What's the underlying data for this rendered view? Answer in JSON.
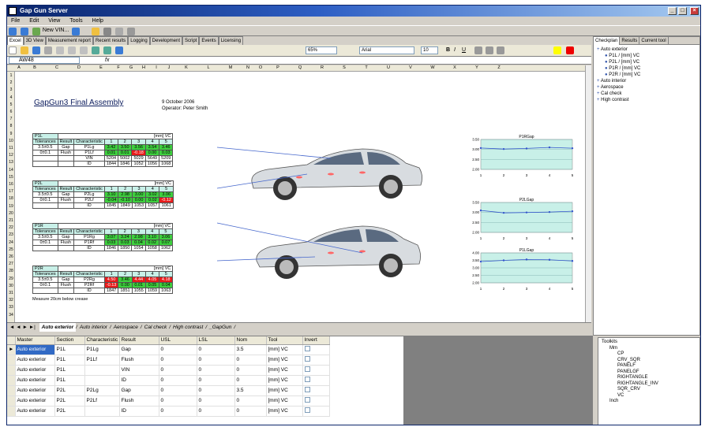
{
  "window": {
    "title": "Gap Gun Server"
  },
  "menu": [
    "File",
    "Edit",
    "View",
    "Tools",
    "Help"
  ],
  "toolbar": {
    "new_vin": "New VIN..."
  },
  "main_tabs": [
    "Excel",
    "3D View",
    "Measurement report",
    "Recent results",
    "Logging",
    "Development",
    "Script",
    "Events",
    "Licensing"
  ],
  "formatbar": {
    "zoom": "65%",
    "font": "Arial",
    "size": "10"
  },
  "namebox": "AW48",
  "fx": "fx",
  "columns": [
    "A",
    "B",
    "C",
    "D",
    "E",
    "F",
    "G",
    "H",
    "I",
    "J",
    "K",
    "L",
    "M",
    "N",
    "O",
    "P",
    "Q",
    "R",
    "S",
    "T",
    "U",
    "V",
    "W",
    "X",
    "Y",
    "Z"
  ],
  "sheet": {
    "title": "GapGun3 Final Assembly",
    "date": "9 October 2006",
    "operator": "Operator: Peter Smith",
    "footnote": "Measure 20cm below crease",
    "tables": [
      {
        "id": "P1L",
        "unit": "[mm] VC",
        "tol_label": "Tolerances",
        "res_label": "Result",
        "char_label": "Characteristic",
        "tol": [
          "3.5±0.5",
          "0±0.1"
        ],
        "rows": [
          {
            "res": "Gap",
            "char": "P1Lg",
            "vals": [
              "3.42",
              "3.50",
              "3.56",
              "3.54",
              "3.46"
            ],
            "cls": [
              "g",
              "g",
              "g",
              "g",
              "g"
            ]
          },
          {
            "res": "Flush",
            "char": "P1Lf",
            "vals": [
              "0.01",
              "0.01",
              "-0.18",
              "0.00",
              "0.03"
            ],
            "cls": [
              "g",
              "g",
              "r",
              "g",
              "g"
            ]
          },
          {
            "res": "",
            "char": "VIN",
            "vals": [
              "5204",
              "5002",
              "5029",
              "5649",
              "5209"
            ],
            "cls": [
              "",
              "",
              "",
              "",
              ""
            ]
          },
          {
            "res": "",
            "char": "ID",
            "vals": [
              "1844",
              "1846",
              "1052",
              "1056",
              "1068"
            ],
            "cls": [
              "",
              "",
              "",
              "",
              ""
            ]
          }
        ]
      },
      {
        "id": "P2L",
        "unit": "[mm] VC",
        "tol_label": "Tolerances",
        "res_label": "Result",
        "char_label": "Characteristic",
        "tol": [
          "3.5±0.5",
          "0±0.1"
        ],
        "rows": [
          {
            "res": "Gap",
            "char": "P2Lg",
            "vals": [
              "3.10",
              "2.98",
              "3.00",
              "3.02",
              "3.06"
            ],
            "cls": [
              "g",
              "g",
              "g",
              "g",
              "g"
            ]
          },
          {
            "res": "Flush",
            "char": "P2Lf",
            "vals": [
              "-0.04",
              "-0.10",
              "0.00",
              "0.02",
              "-0.12"
            ],
            "cls": [
              "g",
              "g",
              "g",
              "g",
              "r"
            ]
          },
          {
            "res": "",
            "char": "ID",
            "vals": [
              "1845",
              "1849",
              "1053",
              "1057",
              "1061"
            ],
            "cls": [
              "",
              "",
              "",
              "",
              ""
            ]
          }
        ]
      },
      {
        "id": "P1R",
        "unit": "[mm] VC",
        "tol_label": "Tolerances",
        "res_label": "Result",
        "char_label": "Characteristic",
        "tol": [
          "3.5±0.5",
          "0±0.1"
        ],
        "note": "...\\Manage.cap\\sound\\GapGun3\\meas... INW...",
        "rows": [
          {
            "res": "Gap",
            "char": "P1Rg",
            "vals": [
              "3.07",
              "3.24",
              "2.98",
              "3.10",
              "3.06"
            ],
            "cls": [
              "g",
              "g",
              "g",
              "g",
              "g"
            ]
          },
          {
            "res": "Flush",
            "char": "P1Rf",
            "vals": [
              "0.03",
              "0.03",
              "0.04",
              "0.02",
              "0.07"
            ],
            "cls": [
              "g",
              "g",
              "g",
              "g",
              "g"
            ]
          },
          {
            "res": "",
            "char": "ID",
            "vals": [
              "1846",
              "1850",
              "1054",
              "1058",
              "1062"
            ],
            "cls": [
              "",
              "",
              "",
              "",
              ""
            ]
          }
        ]
      },
      {
        "id": "P2R",
        "unit": "[mm] VC",
        "tol_label": "Tolerances",
        "res_label": "Result",
        "char_label": "Characteristic",
        "tol": [
          "3.5±0.5",
          "0±0.1"
        ],
        "note": "INW...",
        "rows": [
          {
            "res": "Gap",
            "char": "P2Rg",
            "vals": [
              "4.50",
              "3.46",
              "4.44",
              "4.05",
              "4.18"
            ],
            "cls": [
              "r",
              "g",
              "r",
              "r",
              "r"
            ]
          },
          {
            "res": "Flush",
            "char": "P2Rf",
            "vals": [
              "-0.13",
              "0.00",
              "0.01",
              "0.05",
              "0.04"
            ],
            "cls": [
              "r",
              "g",
              "g",
              "g",
              "g"
            ]
          },
          {
            "res": "",
            "char": "ID",
            "vals": [
              "1847",
              "1851",
              "1055",
              "1059",
              "1063"
            ],
            "cls": [
              "",
              "",
              "",
              "",
              ""
            ]
          }
        ]
      }
    ],
    "col_nums": [
      "1",
      "2",
      "3",
      "4",
      "5"
    ]
  },
  "chart_data": [
    {
      "type": "line",
      "title": "P1RGap",
      "x": [
        1,
        2,
        3,
        4,
        5
      ],
      "values": [
        3.07,
        3.02,
        3.05,
        3.1,
        3.06
      ],
      "ylim": [
        2.0,
        3.5
      ],
      "yticks": [
        "3.50",
        "3.00",
        "2.50",
        "2.00"
      ]
    },
    {
      "type": "line",
      "title": "P2LGap",
      "x": [
        1,
        2,
        3,
        4,
        5
      ],
      "values": [
        3.1,
        2.98,
        3.0,
        3.02,
        3.06
      ],
      "ylim": [
        2.0,
        3.5
      ],
      "yticks": [
        "3.50",
        "3.00",
        "2.50",
        "2.00"
      ]
    },
    {
      "type": "line",
      "title": "P1LGap",
      "x": [
        1,
        2,
        3,
        4,
        5
      ],
      "values": [
        3.42,
        3.5,
        3.56,
        3.54,
        3.46
      ],
      "ylim": [
        2.0,
        4.0
      ],
      "yticks": [
        "4.00",
        "3.50",
        "3.00",
        "2.50",
        "2.00"
      ]
    }
  ],
  "sheet_tabs": [
    "Auto exterior",
    "Auto interior",
    "Aerospace",
    "Cal check",
    "High contrast",
    "_GapGun"
  ],
  "right_tabs": [
    "Checkplan",
    "Results",
    "Current tool"
  ],
  "tree": [
    {
      "t": "Auto exterior",
      "lvl": 0
    },
    {
      "t": "P1L / [mm] VC",
      "lvl": 1
    },
    {
      "t": "P2L / [mm] VC",
      "lvl": 1
    },
    {
      "t": "P1R / [mm] VC",
      "lvl": 1
    },
    {
      "t": "P2R / [mm] VC",
      "lvl": 1
    },
    {
      "t": "Auto interior",
      "lvl": 0
    },
    {
      "t": "Aerospace",
      "lvl": 0
    },
    {
      "t": "Cal check",
      "lvl": 0
    },
    {
      "t": "High contrast",
      "lvl": 0
    }
  ],
  "grid": {
    "headers": [
      "Master",
      "Section",
      "Characteristic",
      "Result",
      "USL",
      "LSL",
      "Nom",
      "Tool",
      "Invert"
    ],
    "rows": [
      [
        "Auto exterior",
        "P1L",
        "P1Lg",
        "Gap",
        "0",
        "0",
        "3.5",
        "[mm] VC"
      ],
      [
        "Auto exterior",
        "P1L",
        "P1Lf",
        "Flush",
        "0",
        "0",
        "0",
        "[mm] VC"
      ],
      [
        "Auto exterior",
        "P1L",
        "",
        "VIN",
        "0",
        "0",
        "0",
        "[mm] VC"
      ],
      [
        "Auto exterior",
        "P1L",
        "",
        "ID",
        "0",
        "0",
        "0",
        "[mm] VC"
      ],
      [
        "Auto exterior",
        "P2L",
        "P2Lg",
        "Gap",
        "0",
        "0",
        "3.5",
        "[mm] VC"
      ],
      [
        "Auto exterior",
        "P2L",
        "P2Lf",
        "Flush",
        "0",
        "0",
        "0",
        "[mm] VC"
      ],
      [
        "Auto exterior",
        "P2L",
        "",
        "ID",
        "0",
        "0",
        "0",
        "[mm] VC"
      ]
    ]
  },
  "toolkits": {
    "title": "Toolkits",
    "items": [
      {
        "t": "Mm",
        "lvl": 1
      },
      {
        "t": "CP",
        "lvl": 2
      },
      {
        "t": "CRV_SQR",
        "lvl": 2
      },
      {
        "t": "PANELF",
        "lvl": 2
      },
      {
        "t": "PANELGF",
        "lvl": 2
      },
      {
        "t": "RIGHTANGLE",
        "lvl": 2
      },
      {
        "t": "RIGHTANGLE_INV",
        "lvl": 2
      },
      {
        "t": "SQR_CRV",
        "lvl": 2
      },
      {
        "t": "VC",
        "lvl": 2
      },
      {
        "t": "Inch",
        "lvl": 1
      }
    ]
  }
}
